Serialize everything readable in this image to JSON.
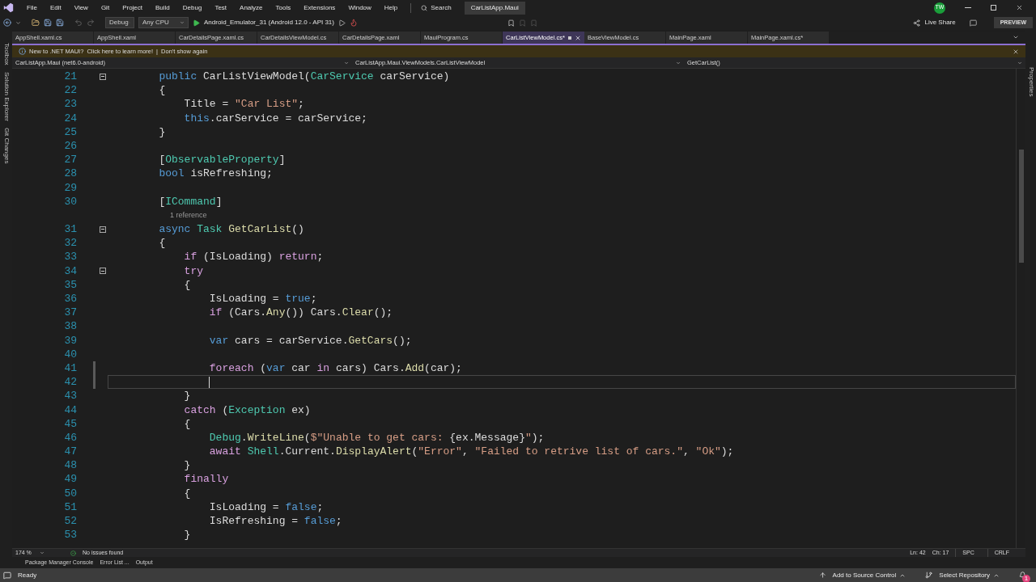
{
  "menu": [
    "File",
    "Edit",
    "View",
    "Git",
    "Project",
    "Build",
    "Debug",
    "Test",
    "Analyze",
    "Tools",
    "Extensions",
    "Window",
    "Help"
  ],
  "search": "Search",
  "solution_title": "CarListApp.Maui",
  "avatar": "TW",
  "toolbar": {
    "configuration": "Debug",
    "platform": "Any CPU",
    "target": "Android_Emulator_31 (Android 12.0 - API 31)",
    "live_share": "Live Share",
    "preview": "PREVIEW"
  },
  "side_left": [
    "Toolbox",
    "Solution Explorer",
    "Git Changes"
  ],
  "side_right": [
    "Properties"
  ],
  "tabs": [
    {
      "label": "AppShell.xaml.cs",
      "selected": false
    },
    {
      "label": "AppShell.xaml",
      "selected": false
    },
    {
      "label": "CarDetailsPage.xaml.cs",
      "selected": false
    },
    {
      "label": "CarDetailsViewModel.cs",
      "selected": false
    },
    {
      "label": "CarDetailsPage.xaml",
      "selected": false
    },
    {
      "label": "MauiProgram.cs",
      "selected": false
    },
    {
      "label": "CarListViewModel.cs*",
      "selected": true
    },
    {
      "label": "BaseViewModel.cs",
      "selected": false
    },
    {
      "label": "MainPage.xaml",
      "selected": false
    },
    {
      "label": "MainPage.xaml.cs*",
      "selected": false
    }
  ],
  "info_bar": {
    "message": "New to .NET MAUI?",
    "link": "Click here to learn more!",
    "separator": "|",
    "dismiss": "Don't show again"
  },
  "nav_bar": {
    "project": "CarListApp.Maui (net6.0-android)",
    "type": "CarListApp.Maui.ViewModels.CarListViewModel",
    "member": "GetCarList()"
  },
  "code": [
    {
      "number": "21",
      "foldable": true,
      "tokens": [
        {
          "text": "        public ",
          "kind": "kw"
        },
        {
          "text": "CarListViewModel(",
          "kind": "plain"
        },
        {
          "text": "CarService",
          "kind": "type"
        },
        {
          "text": " carService)",
          "kind": "plain"
        }
      ]
    },
    {
      "number": "22",
      "tokens": [
        {
          "text": "        {",
          "kind": "plain"
        }
      ]
    },
    {
      "number": "23",
      "tokens": [
        {
          "text": "            Title = ",
          "kind": "plain"
        },
        {
          "text": "\"Car List\"",
          "kind": "str"
        },
        {
          "text": ";",
          "kind": "plain"
        }
      ]
    },
    {
      "number": "24",
      "tokens": [
        {
          "text": "            this",
          "kind": "kw"
        },
        {
          "text": ".carService = carService;",
          "kind": "plain"
        }
      ]
    },
    {
      "number": "25",
      "tokens": [
        {
          "text": "        }",
          "kind": "plain"
        }
      ]
    },
    {
      "number": "26"
    },
    {
      "number": "27",
      "tokens": [
        {
          "text": "        [",
          "kind": "plain"
        },
        {
          "text": "ObservableProperty",
          "kind": "type"
        },
        {
          "text": "]",
          "kind": "plain"
        }
      ]
    },
    {
      "number": "28",
      "tokens": [
        {
          "text": "        bool",
          "kind": "kw"
        },
        {
          "text": " isRefreshing;",
          "kind": "plain"
        }
      ]
    },
    {
      "number": "29"
    },
    {
      "number": "30",
      "tokens": [
        {
          "text": "        [",
          "kind": "plain"
        },
        {
          "text": "ICommand",
          "kind": "type"
        },
        {
          "text": "]",
          "kind": "plain"
        }
      ]
    },
    {
      "number": "31",
      "foldable": true,
      "codelens": "1 reference",
      "tokens": [
        {
          "text": "        async ",
          "kind": "kw"
        },
        {
          "text": "Task",
          "kind": "type"
        },
        {
          "text": " GetCarList",
          "kind": "method"
        },
        {
          "text": "()",
          "kind": "plain"
        }
      ]
    },
    {
      "number": "32",
      "tokens": [
        {
          "text": "        {",
          "kind": "plain"
        }
      ]
    },
    {
      "number": "33",
      "tokens": [
        {
          "text": "            if",
          "kind": "ctrl"
        },
        {
          "text": " (IsLoading) ",
          "kind": "plain"
        },
        {
          "text": "return",
          "kind": "ctrl"
        },
        {
          "text": ";",
          "kind": "plain"
        }
      ]
    },
    {
      "number": "34",
      "foldable": true,
      "tokens": [
        {
          "text": "            try",
          "kind": "ctrl"
        }
      ]
    },
    {
      "number": "35",
      "tokens": [
        {
          "text": "            {",
          "kind": "plain"
        }
      ]
    },
    {
      "number": "36",
      "tokens": [
        {
          "text": "                IsLoading = ",
          "kind": "plain"
        },
        {
          "text": "true",
          "kind": "kw"
        },
        {
          "text": ";",
          "kind": "plain"
        }
      ]
    },
    {
      "number": "37",
      "tokens": [
        {
          "text": "                if",
          "kind": "ctrl"
        },
        {
          "text": " (Cars.",
          "kind": "plain"
        },
        {
          "text": "Any",
          "kind": "method"
        },
        {
          "text": "()) Cars.",
          "kind": "plain"
        },
        {
          "text": "Clear",
          "kind": "method"
        },
        {
          "text": "();",
          "kind": "plain"
        }
      ]
    },
    {
      "number": "38"
    },
    {
      "number": "39",
      "tokens": [
        {
          "text": "                var",
          "kind": "kw"
        },
        {
          "text": " cars = carService.",
          "kind": "plain"
        },
        {
          "text": "GetCars",
          "kind": "method"
        },
        {
          "text": "();",
          "kind": "plain"
        }
      ]
    },
    {
      "number": "40"
    },
    {
      "number": "41",
      "modified": true,
      "tokens": [
        {
          "text": "                foreach",
          "kind": "ctrl"
        },
        {
          "text": " (",
          "kind": "plain"
        },
        {
          "text": "var",
          "kind": "kw"
        },
        {
          "text": " car ",
          "kind": "plain"
        },
        {
          "text": "in",
          "kind": "ctrl"
        },
        {
          "text": " cars) Cars.",
          "kind": "plain"
        },
        {
          "text": "Add",
          "kind": "method"
        },
        {
          "text": "(car);",
          "kind": "plain"
        }
      ]
    },
    {
      "number": "42",
      "modified": true,
      "current": true
    },
    {
      "number": "43",
      "tokens": [
        {
          "text": "            }",
          "kind": "plain"
        }
      ]
    },
    {
      "number": "44",
      "tokens": [
        {
          "text": "            catch",
          "kind": "ctrl"
        },
        {
          "text": " (",
          "kind": "plain"
        },
        {
          "text": "Exception",
          "kind": "type"
        },
        {
          "text": " ex)",
          "kind": "plain"
        }
      ]
    },
    {
      "number": "45",
      "tokens": [
        {
          "text": "            {",
          "kind": "plain"
        }
      ]
    },
    {
      "number": "46",
      "tokens": [
        {
          "text": "                Debug",
          "kind": "type"
        },
        {
          "text": ".",
          "kind": "plain"
        },
        {
          "text": "WriteLine",
          "kind": "method"
        },
        {
          "text": "(",
          "kind": "plain"
        },
        {
          "text": "$\"Unable to get cars: ",
          "kind": "str"
        },
        {
          "text": "{ex.Message}",
          "kind": "plain"
        },
        {
          "text": "\"",
          "kind": "str"
        },
        {
          "text": ");",
          "kind": "plain"
        }
      ]
    },
    {
      "number": "47",
      "tokens": [
        {
          "text": "                await ",
          "kind": "ctrl"
        },
        {
          "text": "Shell",
          "kind": "type"
        },
        {
          "text": ".Current.",
          "kind": "plain"
        },
        {
          "text": "DisplayAlert",
          "kind": "method"
        },
        {
          "text": "(",
          "kind": "plain"
        },
        {
          "text": "\"Error\"",
          "kind": "str"
        },
        {
          "text": ", ",
          "kind": "plain"
        },
        {
          "text": "\"Failed to retrive list of cars.\"",
          "kind": "str"
        },
        {
          "text": ", ",
          "kind": "plain"
        },
        {
          "text": "\"Ok\"",
          "kind": "str"
        },
        {
          "text": ");",
          "kind": "plain"
        }
      ]
    },
    {
      "number": "48",
      "tokens": [
        {
          "text": "            }",
          "kind": "plain"
        }
      ]
    },
    {
      "number": "49",
      "tokens": [
        {
          "text": "            finally",
          "kind": "ctrl"
        }
      ]
    },
    {
      "number": "50",
      "tokens": [
        {
          "text": "            {",
          "kind": "plain"
        }
      ]
    },
    {
      "number": "51",
      "tokens": [
        {
          "text": "                IsLoading = ",
          "kind": "plain"
        },
        {
          "text": "false",
          "kind": "kw"
        },
        {
          "text": ";",
          "kind": "plain"
        }
      ]
    },
    {
      "number": "52",
      "tokens": [
        {
          "text": "                IsRefreshing = ",
          "kind": "plain"
        },
        {
          "text": "false",
          "kind": "kw"
        },
        {
          "text": ";",
          "kind": "plain"
        }
      ]
    },
    {
      "number": "53",
      "tokens": [
        {
          "text": "            }",
          "kind": "plain"
        }
      ]
    }
  ],
  "editor_status": {
    "zoom": "174 %",
    "issues": "No issues found",
    "line": "Ln: 42",
    "column": "Ch: 17",
    "whitespace": "SPC",
    "line_endings": "CRLF"
  },
  "tool_tabs": [
    "Package Manager Console",
    "Error List ...",
    "Output"
  ],
  "status_bar": {
    "state": "Ready",
    "source_control": "Add to Source Control",
    "repository": "Select Repository",
    "notifications": "1"
  }
}
